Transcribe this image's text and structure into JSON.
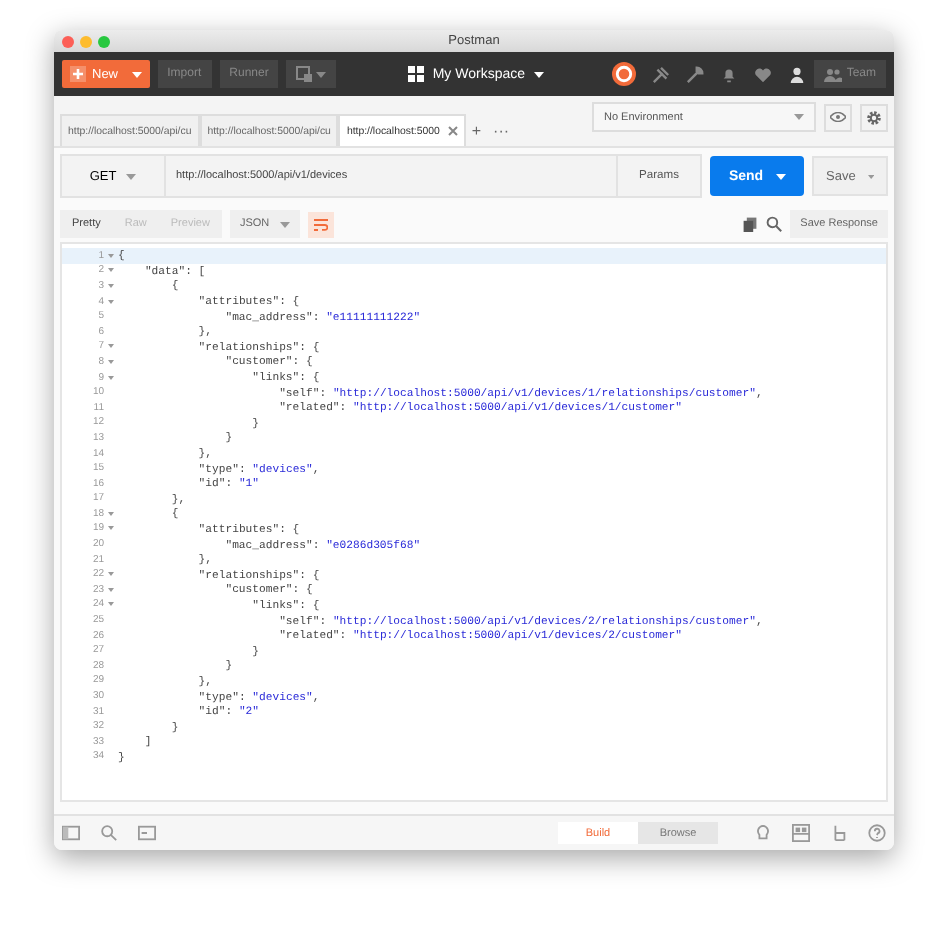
{
  "window": {
    "title": "Postman"
  },
  "toolbar": {
    "new_button": "New",
    "import_button": "Import",
    "runner_button": "Runner",
    "workspace": "My Workspace",
    "team_button": "Team"
  },
  "request_tabs": [
    {
      "label": "http://localhost:5000/api/cu",
      "selected": false
    },
    {
      "label": "http://localhost:5000/api/cu",
      "selected": false
    },
    {
      "label": "http://localhost:5000",
      "selected": true
    }
  ],
  "new_tab": "+",
  "more_tabs": "···",
  "environment": "No Environment",
  "request": {
    "method": "GET",
    "url": "http://localhost:5000/api/v1/devices",
    "params_button": "Params",
    "send_button": "Send",
    "save_button": "Save"
  },
  "response": {
    "view_tabs": [
      {
        "label": "Pretty",
        "selected": true
      },
      {
        "label": "Raw",
        "selected": false
      },
      {
        "label": "Preview",
        "selected": false
      }
    ],
    "format": "JSON",
    "wrap_lines": true,
    "save_button": "Save Response",
    "lines": [
      {
        "number": "1",
        "text": "{",
        "foldable": true,
        "current": true
      },
      {
        "number": "2",
        "text": "    \"data\": [",
        "foldable": true,
        "current": false
      },
      {
        "number": "3",
        "text": "        {",
        "foldable": true,
        "current": false
      },
      {
        "number": "4",
        "text": "            \"attributes\": {",
        "foldable": true,
        "current": false
      },
      {
        "number": "5",
        "text": "                \"mac_address\": \"e11111111222\"",
        "foldable": false,
        "current": false
      },
      {
        "number": "6",
        "text": "            },",
        "foldable": false,
        "current": false
      },
      {
        "number": "7",
        "text": "            \"relationships\": {",
        "foldable": true,
        "current": false
      },
      {
        "number": "8",
        "text": "                \"customer\": {",
        "foldable": true,
        "current": false
      },
      {
        "number": "9",
        "text": "                    \"links\": {",
        "foldable": true,
        "current": false
      },
      {
        "number": "10",
        "text": "                        \"self\": \"http://localhost:5000/api/v1/devices/1/relationships/customer\",",
        "foldable": false,
        "current": false
      },
      {
        "number": "11",
        "text": "                        \"related\": \"http://localhost:5000/api/v1/devices/1/customer\"",
        "foldable": false,
        "current": false
      },
      {
        "number": "12",
        "text": "                    }",
        "foldable": false,
        "current": false
      },
      {
        "number": "13",
        "text": "                }",
        "foldable": false,
        "current": false
      },
      {
        "number": "14",
        "text": "            },",
        "foldable": false,
        "current": false
      },
      {
        "number": "15",
        "text": "            \"type\": \"devices\",",
        "foldable": false,
        "current": false
      },
      {
        "number": "16",
        "text": "            \"id\": \"1\"",
        "foldable": false,
        "current": false
      },
      {
        "number": "17",
        "text": "        },",
        "foldable": false,
        "current": false
      },
      {
        "number": "18",
        "text": "        {",
        "foldable": true,
        "current": false
      },
      {
        "number": "19",
        "text": "            \"attributes\": {",
        "foldable": true,
        "current": false
      },
      {
        "number": "20",
        "text": "                \"mac_address\": \"e0286d305f68\"",
        "foldable": false,
        "current": false
      },
      {
        "number": "21",
        "text": "            },",
        "foldable": false,
        "current": false
      },
      {
        "number": "22",
        "text": "            \"relationships\": {",
        "foldable": true,
        "current": false
      },
      {
        "number": "23",
        "text": "                \"customer\": {",
        "foldable": true,
        "current": false
      },
      {
        "number": "24",
        "text": "                    \"links\": {",
        "foldable": true,
        "current": false
      },
      {
        "number": "25",
        "text": "                        \"self\": \"http://localhost:5000/api/v1/devices/2/relationships/customer\",",
        "foldable": false,
        "current": false
      },
      {
        "number": "26",
        "text": "                        \"related\": \"http://localhost:5000/api/v1/devices/2/customer\"",
        "foldable": false,
        "current": false
      },
      {
        "number": "27",
        "text": "                    }",
        "foldable": false,
        "current": false
      },
      {
        "number": "28",
        "text": "                }",
        "foldable": false,
        "current": false
      },
      {
        "number": "29",
        "text": "            },",
        "foldable": false,
        "current": false
      },
      {
        "number": "30",
        "text": "            \"type\": \"devices\",",
        "foldable": false,
        "current": false
      },
      {
        "number": "31",
        "text": "            \"id\": \"2\"",
        "foldable": false,
        "current": false
      },
      {
        "number": "32",
        "text": "        }",
        "foldable": false,
        "current": false
      },
      {
        "number": "33",
        "text": "    ]",
        "foldable": false,
        "current": false
      },
      {
        "number": "34",
        "text": "}",
        "foldable": false,
        "current": false
      }
    ]
  },
  "footer": {
    "modes": [
      {
        "label": "Build",
        "selected": true
      },
      {
        "label": "Browse",
        "selected": false
      }
    ]
  }
}
